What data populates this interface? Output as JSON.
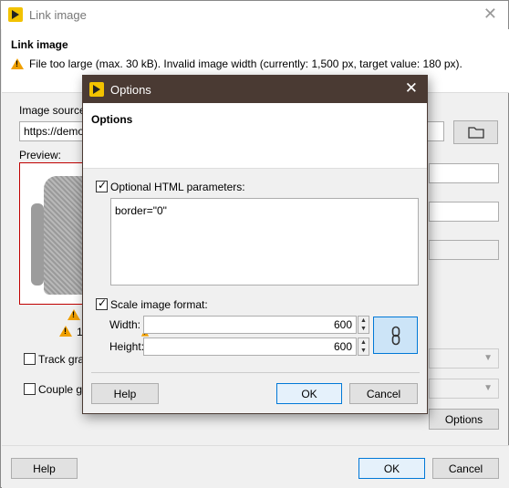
{
  "window": {
    "title": "Link image",
    "close_glyph": "✕"
  },
  "header": {
    "heading": "Link image",
    "warning": "File too large (max. 30 kB). Invalid image width (currently: 1,500 px, target value: 180 px)."
  },
  "main": {
    "image_source_label": "Image source:",
    "image_source_value": "https://demos",
    "preview_label": "Preview:",
    "warning_partial": "1",
    "track_label": "Track grap",
    "couple_label": "Couple gr",
    "options_button": "Options"
  },
  "footer": {
    "help": "Help",
    "ok": "OK",
    "cancel": "Cancel"
  },
  "options_dialog": {
    "title": "Options",
    "close_glyph": "✕",
    "heading": "Options",
    "html_params_label": "Optional HTML parameters:",
    "html_params_checked": true,
    "html_params_value": "border=\"0\"",
    "scale_label": "Scale image format:",
    "scale_checked": true,
    "width_label": "Width:",
    "width_value": "600",
    "height_label": "Height:",
    "height_value": "600",
    "help": "Help",
    "ok": "OK",
    "cancel": "Cancel"
  },
  "icons": {
    "app": "app-logo-icon",
    "warning": "warning-icon",
    "folder": "folder-icon",
    "chain": "chain-link-icon"
  },
  "colors": {
    "dialog_titlebar": "#4a3a33",
    "warning": "#f0a000",
    "preview_border": "#c00000",
    "accent": "#0078d7"
  }
}
